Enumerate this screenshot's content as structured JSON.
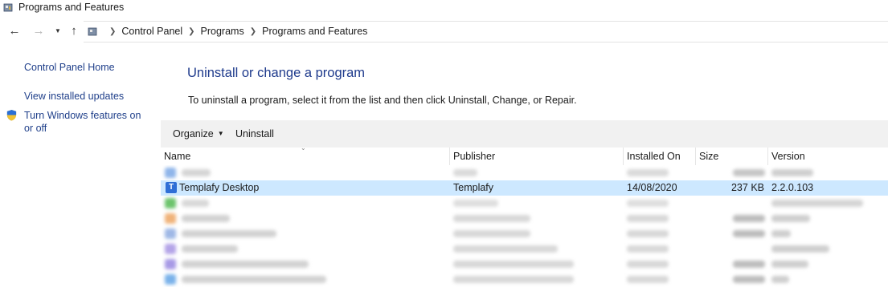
{
  "window": {
    "title": "Programs and Features"
  },
  "address": {
    "crumbs": [
      "Control Panel",
      "Programs",
      "Programs and Features"
    ]
  },
  "sidebar": {
    "home": "Control Panel Home",
    "updates": "View installed updates",
    "features": "Turn Windows features on or off"
  },
  "main": {
    "heading": "Uninstall or change a program",
    "instructions": "To uninstall a program, select it from the list and then click Uninstall, Change, or Repair."
  },
  "toolbar": {
    "organize": "Organize",
    "uninstall": "Uninstall"
  },
  "columns": {
    "name": "Name",
    "publisher": "Publisher",
    "installed_on": "Installed On",
    "size": "Size",
    "version": "Version"
  },
  "selected_program": {
    "name": "Templafy Desktop",
    "publisher": "Templafy",
    "installed_on": "14/08/2020",
    "size": "237 KB",
    "version": "2.2.0.103",
    "icon_letter": "T"
  },
  "colors": {
    "accent": "#1e3a8c",
    "link": "#1f3f8a",
    "selection": "#cde8ff",
    "toolbar": "#f1f1f1"
  },
  "icons": [
    "control-panel-icon",
    "back-arrow-icon",
    "forward-arrow-icon",
    "chevron-down-icon",
    "up-arrow-icon",
    "uac-shield-icon",
    "templafy-app-icon",
    "sort-arrow-icon"
  ]
}
